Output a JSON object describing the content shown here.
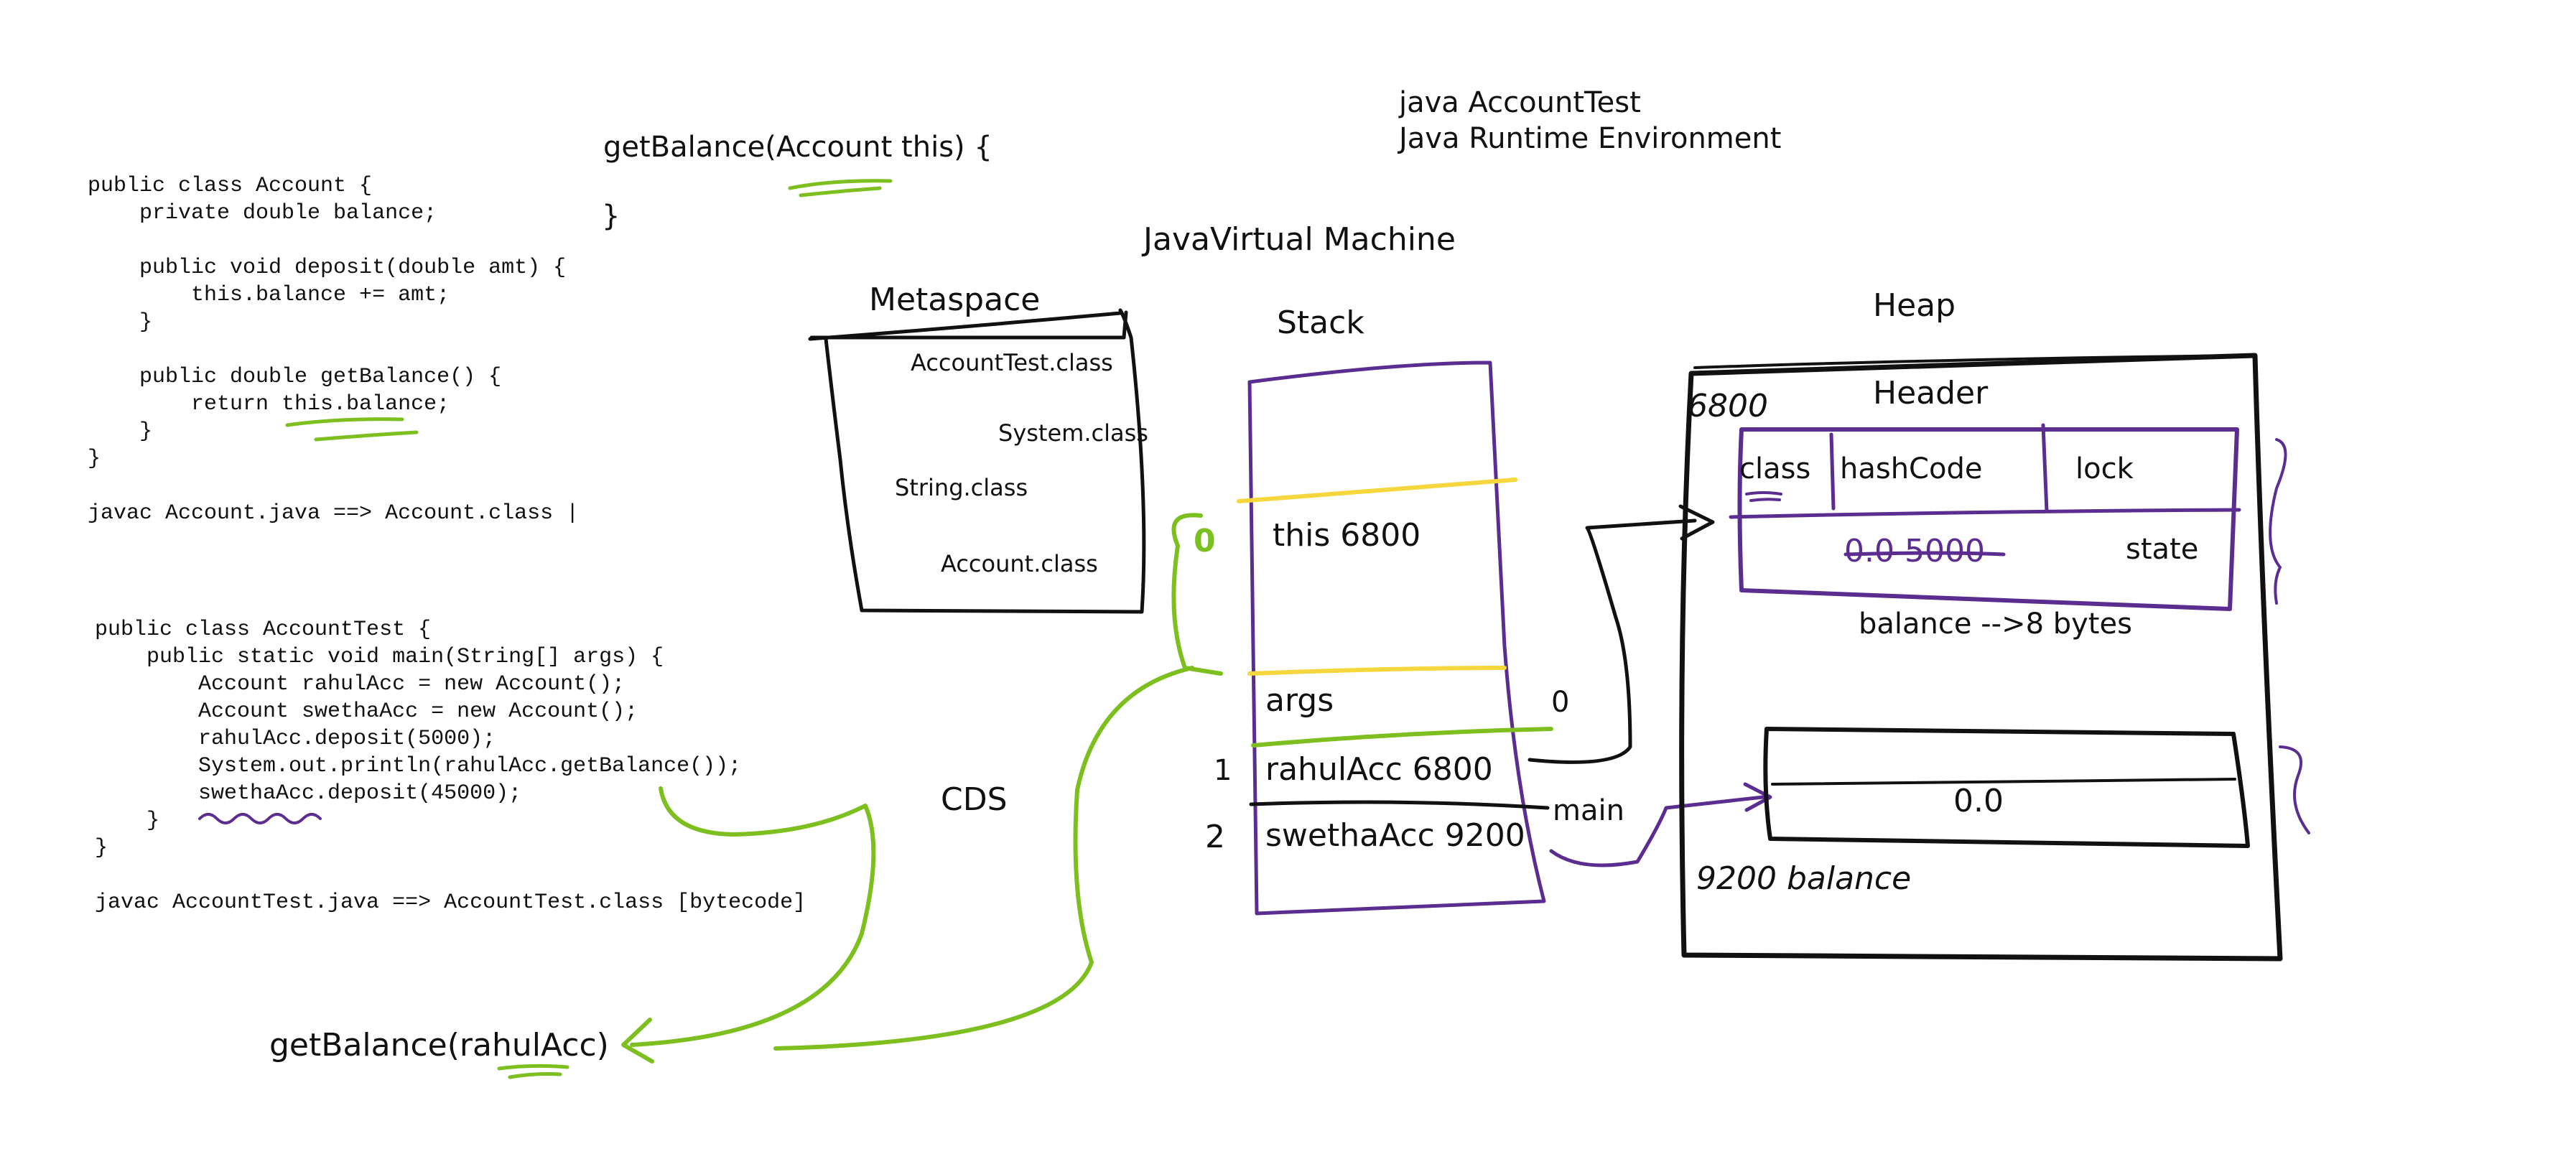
{
  "account_code": [
    "public class Account {",
    "    private double balance;",
    "",
    "    public void deposit(double amt) {",
    "        this.balance += amt;",
    "    }",
    "",
    "    public double getBalance() {",
    "        return this.balance;",
    "    }",
    "}",
    "",
    "javac Account.java ==> Account.class |"
  ],
  "test_code": [
    "public class AccountTest {",
    "    public static void main(String[] args) {",
    "        Account rahulAcc = new Account();",
    "        Account swethaAcc = new Account();",
    "        rahulAcc.deposit(5000);",
    "        System.out.println(rahulAcc.getBalance());",
    "        swethaAcc.deposit(45000);",
    "    }",
    "}",
    "",
    "javac AccountTest.java ==> AccountTest.class [bytecode]"
  ],
  "notes": {
    "get_balance_sig": "getBalance(Account this) {",
    "close_brace": "}",
    "run_cmd": "java AccountTest",
    "jre": "Java Runtime Environment",
    "jvm": "JavaVirtual Machine",
    "cds": "CDS",
    "get_balance_call": "getBalance(rahulAcc)"
  },
  "metaspace": {
    "title": "Metaspace",
    "classes": [
      "AccountTest.class",
      "System.class",
      "String.class",
      "Account.class"
    ]
  },
  "stack": {
    "title": "Stack",
    "frame_top_index": "0",
    "this_slot": "this 6800",
    "slot_index_0": "0",
    "args_slot": "args",
    "slot_index_1": "1",
    "rahul_slot": "rahulAcc 6800",
    "slot_index_2": "2",
    "swetha_slot": "swethaAcc 9200",
    "frame_label": "main"
  },
  "heap": {
    "title": "Heap",
    "object1_address": "6800",
    "header_label": "Header",
    "header_fields": [
      "class",
      "hashCode",
      "lock"
    ],
    "state_value": "0.0 5000",
    "state_label": "state",
    "balance_note": "balance -->8 bytes",
    "object2_value": "0.0",
    "object2_note": "9200 balance"
  },
  "colors": {
    "ink": "#111111",
    "green": "#7cbf1e",
    "purple": "#5c2d91",
    "yellow": "#f5d63d"
  }
}
